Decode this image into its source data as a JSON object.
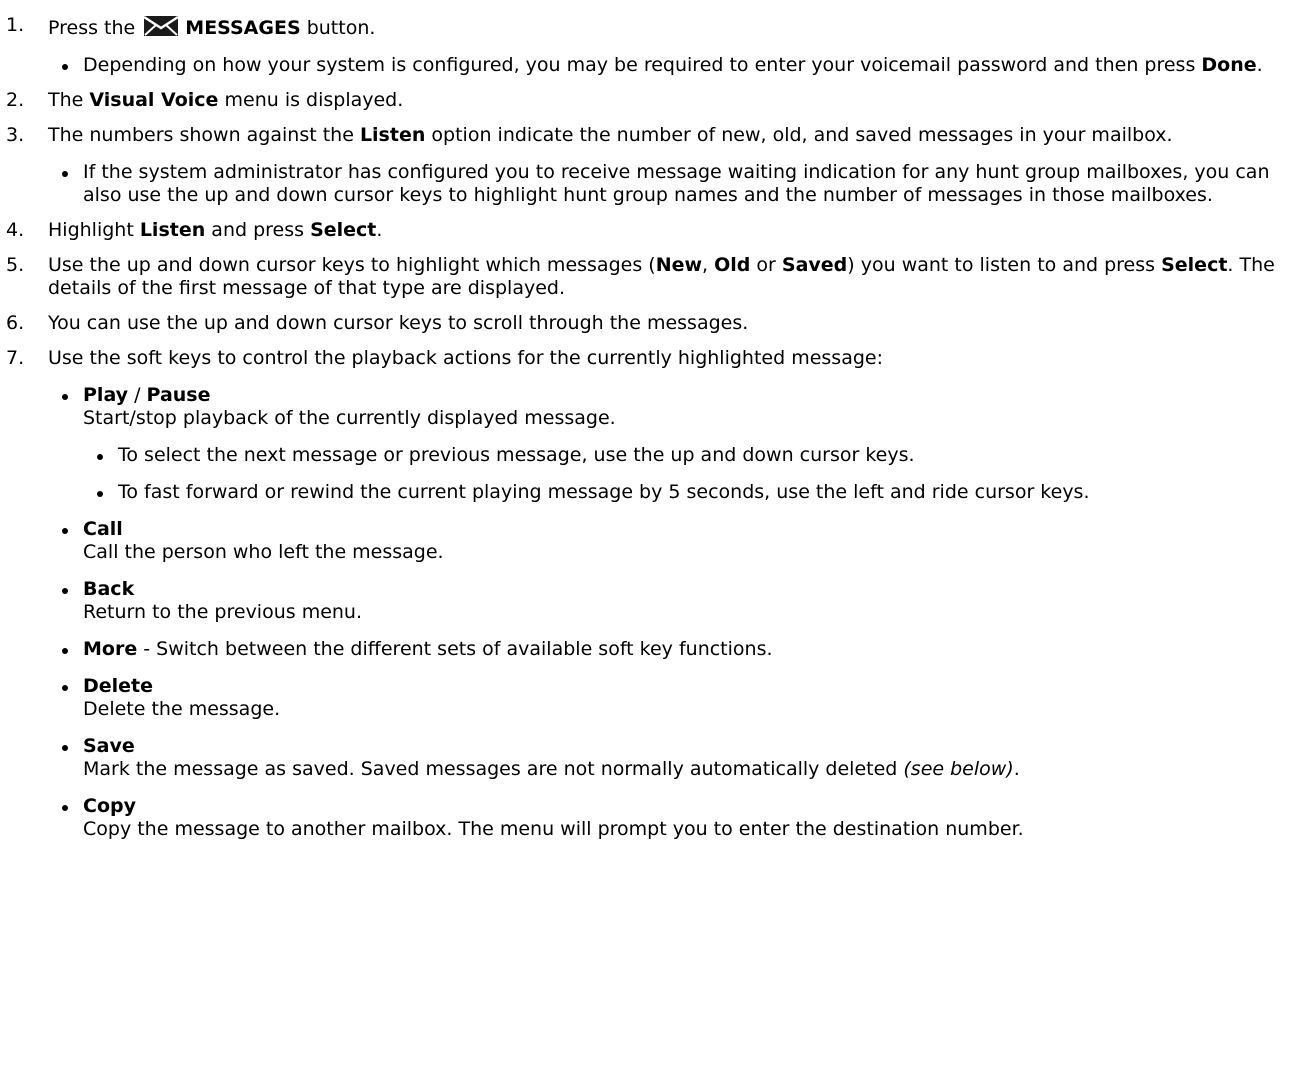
{
  "steps": [
    {
      "num": "1.",
      "pre": "Press the",
      "icon": "envelope-icon",
      "bold": "MESSAGES",
      "post": "button.",
      "bullets": [
        {
          "a": "Depending on how your system is configured, you may be required to enter your voicemail password and then press ",
          "b": "Done",
          "c": "."
        }
      ]
    },
    {
      "num": "2.",
      "a": "The ",
      "b": "Visual Voice",
      "c": " menu is displayed."
    },
    {
      "num": "3.",
      "a": "The numbers shown against the ",
      "b": "Listen",
      "c": " option indicate the number of new, old, and saved messages in your mailbox.",
      "bullet": "If the system administrator has configured you to receive message waiting indication for any hunt group mailboxes, you can also use the up and down cursor keys to highlight hunt group names and the number of messages in those mailboxes."
    },
    {
      "num": "4.",
      "a": "Highlight ",
      "b": "Listen",
      "c": " and press ",
      "d": "Select",
      "e": "."
    },
    {
      "num": "5.",
      "a": "Use the up and down cursor keys to highlight which messages (",
      "b": "New",
      "c": ", ",
      "d": "Old",
      "e": " or ",
      "f": "Saved",
      "g": ") you want to listen to and press ",
      "h": "Select",
      "i": ". The details of the first message of that type are displayed."
    },
    {
      "num": "6.",
      "a": "You can use the up and down cursor keys to scroll through the messages."
    },
    {
      "num": "7.",
      "a": "Use the soft keys to control the playback actions for the currently highlighted message:",
      "keys": {
        "play": "Play",
        "sep": " / ",
        "pause": "Pause",
        "play_desc": "Start/stop playback of the currently displayed message.",
        "play_sub1": "To select the next message or previous message, use the up and down cursor keys.",
        "play_sub2": "To fast forward or rewind the current playing message by 5 seconds, use the left and ride cursor keys.",
        "call": "Call",
        "call_desc": "Call the person who left the message.",
        "back": "Back",
        "back_desc": "Return to the previous menu.",
        "more": "More",
        "more_desc": " - Switch between the different sets of available soft key functions.",
        "delete": "Delete",
        "delete_desc": "Delete the message.",
        "save": "Save",
        "save_desc": "Mark the message as saved. Saved messages are not normally automatically deleted ",
        "save_note": "(see below)",
        "save_end": ".",
        "copy": "Copy",
        "copy_desc": "Copy the message to another mailbox. The menu will prompt you to enter the destination number."
      }
    }
  ]
}
